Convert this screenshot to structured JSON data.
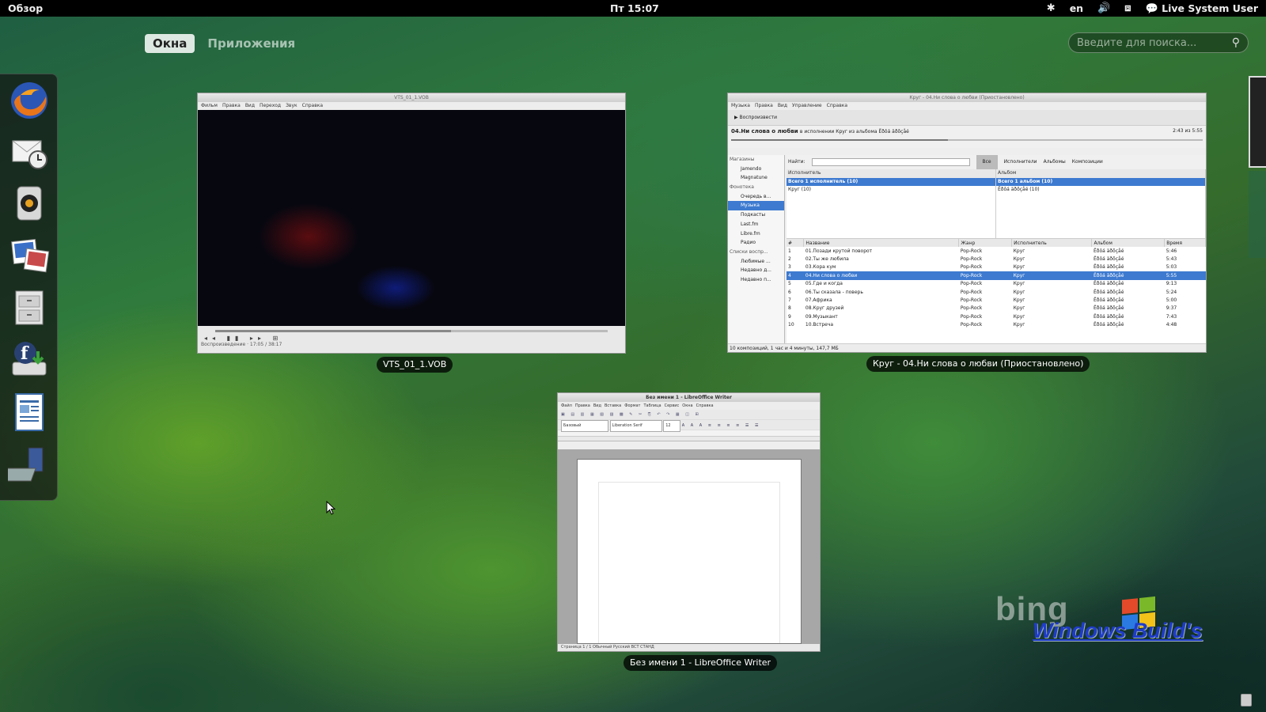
{
  "topbar": {
    "activities": "Обзор",
    "clock": "Пт 15:07",
    "lang": "en",
    "user": "Live System User"
  },
  "overview": {
    "tabs": [
      "Окна",
      "Приложения"
    ],
    "search_placeholder": "Введите для поиска..."
  },
  "dash": {
    "apps": [
      "firefox-icon",
      "evolution-icon",
      "rhythmbox-icon",
      "shotwell-icon",
      "files-icon",
      "fedora-install-icon",
      "writer-icon",
      "workspace-icon"
    ]
  },
  "windows": {
    "video": {
      "caption": "VTS_01_1.VOB",
      "title": "VTS_01_1.VOB",
      "menu": [
        "Фильм",
        "Правка",
        "Вид",
        "Переход",
        "Звук",
        "Справка"
      ],
      "status": "Воспроизведение · 17:05 / 38:17"
    },
    "rhythmbox": {
      "caption": "Круг - 04.Ни слова о любви (Приостановлено)",
      "title": "Круг - 04.Ни слова о любви (Приостановлено)",
      "menu": [
        "Музыка",
        "Правка",
        "Вид",
        "Управление",
        "Справка"
      ],
      "play_label": "Воспроизвести",
      "now_playing": "04.Ни слова о любви",
      "now_playing_sub": "в исполнении Круг из альбома Ёðôá äðõçåé",
      "time": "2:43 из 5:55",
      "sidebar": [
        {
          "label": "Магазины",
          "type": "hdr"
        },
        {
          "label": "Jamendo"
        },
        {
          "label": "Magnatune"
        },
        {
          "label": "Фонотека",
          "type": "hdr"
        },
        {
          "label": "Очередь в..."
        },
        {
          "label": "Музыка",
          "type": "sel"
        },
        {
          "label": "Подкасты"
        },
        {
          "label": "Last.fm"
        },
        {
          "label": "Libre.fm"
        },
        {
          "label": "Радио"
        },
        {
          "label": "Списки воспр...",
          "type": "hdr"
        },
        {
          "label": "Любимые ..."
        },
        {
          "label": "Недавно д..."
        },
        {
          "label": "Недавно п..."
        }
      ],
      "search_label": "Найти:",
      "filters": [
        "Все",
        "Исполнители",
        "Альбомы",
        "Композиции"
      ],
      "artist_header": "Исполнитель",
      "artists": [
        "Всего 1 исполнитель (10)",
        "Круг (10)"
      ],
      "album_header": "Альбом",
      "albums": [
        "Всего 1 альбом (10)",
        "Ёðôá äðõçåé (10)"
      ],
      "columns": [
        "#",
        "Название",
        "Жанр",
        "Исполнитель",
        "Альбом",
        "Время"
      ],
      "tracks": [
        [
          "1",
          "01.Позади крутой поворот",
          "Pop-Rock",
          "Круг",
          "Ёðôá äðõçåé",
          "5:46"
        ],
        [
          "2",
          "02.Ты же любила",
          "Pop-Rock",
          "Круг",
          "Ёðôá äðõçåé",
          "5:43"
        ],
        [
          "3",
          "03.Кора кум",
          "Pop-Rock",
          "Круг",
          "Ёðôá äðõçåé",
          "5:03"
        ],
        [
          "4",
          "04.Ни слова о любви",
          "Pop-Rock",
          "Круг",
          "Ёðôá äðõçåé",
          "5:55"
        ],
        [
          "5",
          "05.Где и когда",
          "Pop-Rock",
          "Круг",
          "Ёðôá äðõçåé",
          "9:13"
        ],
        [
          "6",
          "06.Ты сказала - поверь",
          "Pop-Rock",
          "Круг",
          "Ёðôá äðõçåé",
          "5:24"
        ],
        [
          "7",
          "07.Африка",
          "Pop-Rock",
          "Круг",
          "Ёðôá äðõçåé",
          "5:00"
        ],
        [
          "8",
          "08.Круг друзей",
          "Pop-Rock",
          "Круг",
          "Ёðôá äðõçåé",
          "9:37"
        ],
        [
          "9",
          "09.Музыкант",
          "Pop-Rock",
          "Круг",
          "Ёðôá äðõçåé",
          "7:43"
        ],
        [
          "10",
          "10.Встреча",
          "Pop-Rock",
          "Круг",
          "Ёðôá äðõçåé",
          "4:48"
        ]
      ],
      "selected_track": 4,
      "status": "10 композиций, 1 час и 4 минуты, 147,7 МБ"
    },
    "writer": {
      "caption": "Без имени 1 - LibreOffice Writer",
      "title": "Без имени 1 - LibreOffice Writer",
      "menu": [
        "Файл",
        "Правка",
        "Вид",
        "Вставка",
        "Формат",
        "Таблица",
        "Сервис",
        "Окна",
        "Справка"
      ],
      "style": "Базовый",
      "font": "Liberation Serif",
      "size": "12",
      "status": "Страница 1 / 1    Обычный    Русский    ВСТ  СТАНД"
    }
  },
  "watermark": {
    "bing": "bing",
    "text": "Windows Build's"
  }
}
